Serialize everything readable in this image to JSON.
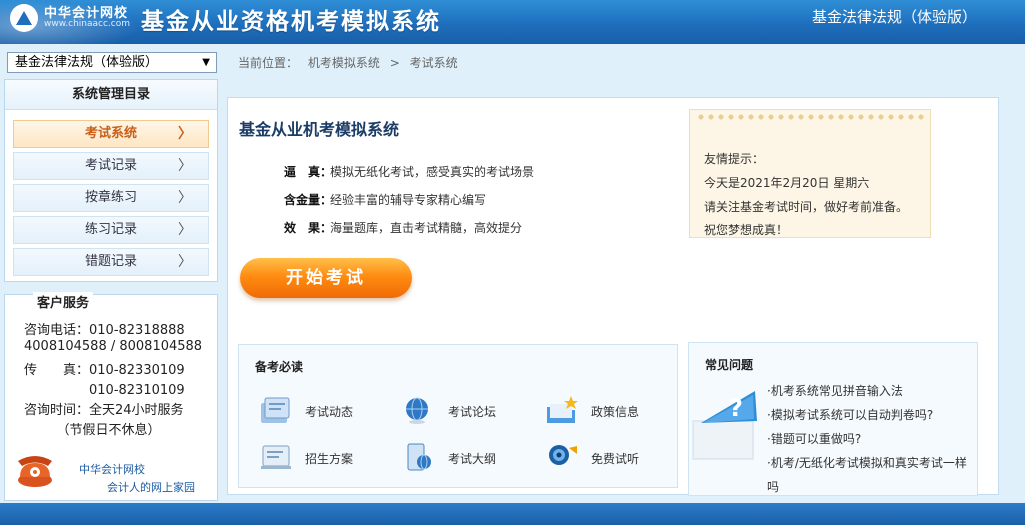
{
  "header": {
    "logo_name": "中华会计网校",
    "logo_url": "www.chinaacc.com",
    "system_title": "基金从业资格机考模拟系统",
    "version": "基金法律法规（体验版）"
  },
  "subject_select": {
    "value": "基金法律法规（体验版）",
    "arrow": "▼"
  },
  "menu": {
    "title": "系统管理目录",
    "items": [
      {
        "label": "考试系统",
        "active": true
      },
      {
        "label": "考试记录"
      },
      {
        "label": "按章练习"
      },
      {
        "label": "练习记录"
      },
      {
        "label": "错题记录"
      }
    ],
    "chevron": "〉"
  },
  "service": {
    "title": "客户服务",
    "lines": [
      "咨询电话：010-82318888",
      "4008104588 / 8008104588",
      "传　　真：010-82330109",
      "　　　　　010-82310109",
      "咨询时间：全天24小时服务",
      "　　　（节假日不休息）"
    ],
    "brand_name": "中华会计网校",
    "brand_slogan": "会计人的网上家园"
  },
  "breadcrumb": {
    "prefix": "当前位置：",
    "path1": "机考模拟系统",
    "sep": ">",
    "path2": "考试系统"
  },
  "main": {
    "title": "基金从业机考模拟系统",
    "features": [
      {
        "label": "逼　真：",
        "text": "模拟无纸化考试，感受真实的考试场景"
      },
      {
        "label": "含金量：",
        "text": "经验丰富的辅导专家精心编写"
      },
      {
        "label": "效　果：",
        "text": "海量题库，直击考试精髓，高效提分"
      }
    ],
    "start_button": "开始考试"
  },
  "notice": {
    "lines": [
      "友情提示：",
      "今天是2021年2月20日 星期六",
      "请关注基金考试时间，做好考前准备。",
      "祝您梦想成真！"
    ]
  },
  "prep": {
    "title": "备考必读",
    "items": [
      {
        "label": "考试动态",
        "icon": "news-icon"
      },
      {
        "label": "考试论坛",
        "icon": "globe-icon"
      },
      {
        "label": "政策信息",
        "icon": "star-folder-icon"
      },
      {
        "label": "招生方案",
        "icon": "document-icon"
      },
      {
        "label": "考试大纲",
        "icon": "outline-icon"
      },
      {
        "label": "免费试听",
        "icon": "audio-icon"
      }
    ]
  },
  "faq": {
    "title": "常见问题",
    "items": [
      "·机考系统常见拼音输入法",
      "·模拟考试系统可以自动判卷吗?",
      "·错题可以重做吗?",
      "·机考/无纸化考试模拟和真实考试一样",
      "吗"
    ]
  },
  "colors": {
    "accent": "#1f6fbd",
    "button_orange": "#ff8c12",
    "active_menu": "#c8601a"
  }
}
